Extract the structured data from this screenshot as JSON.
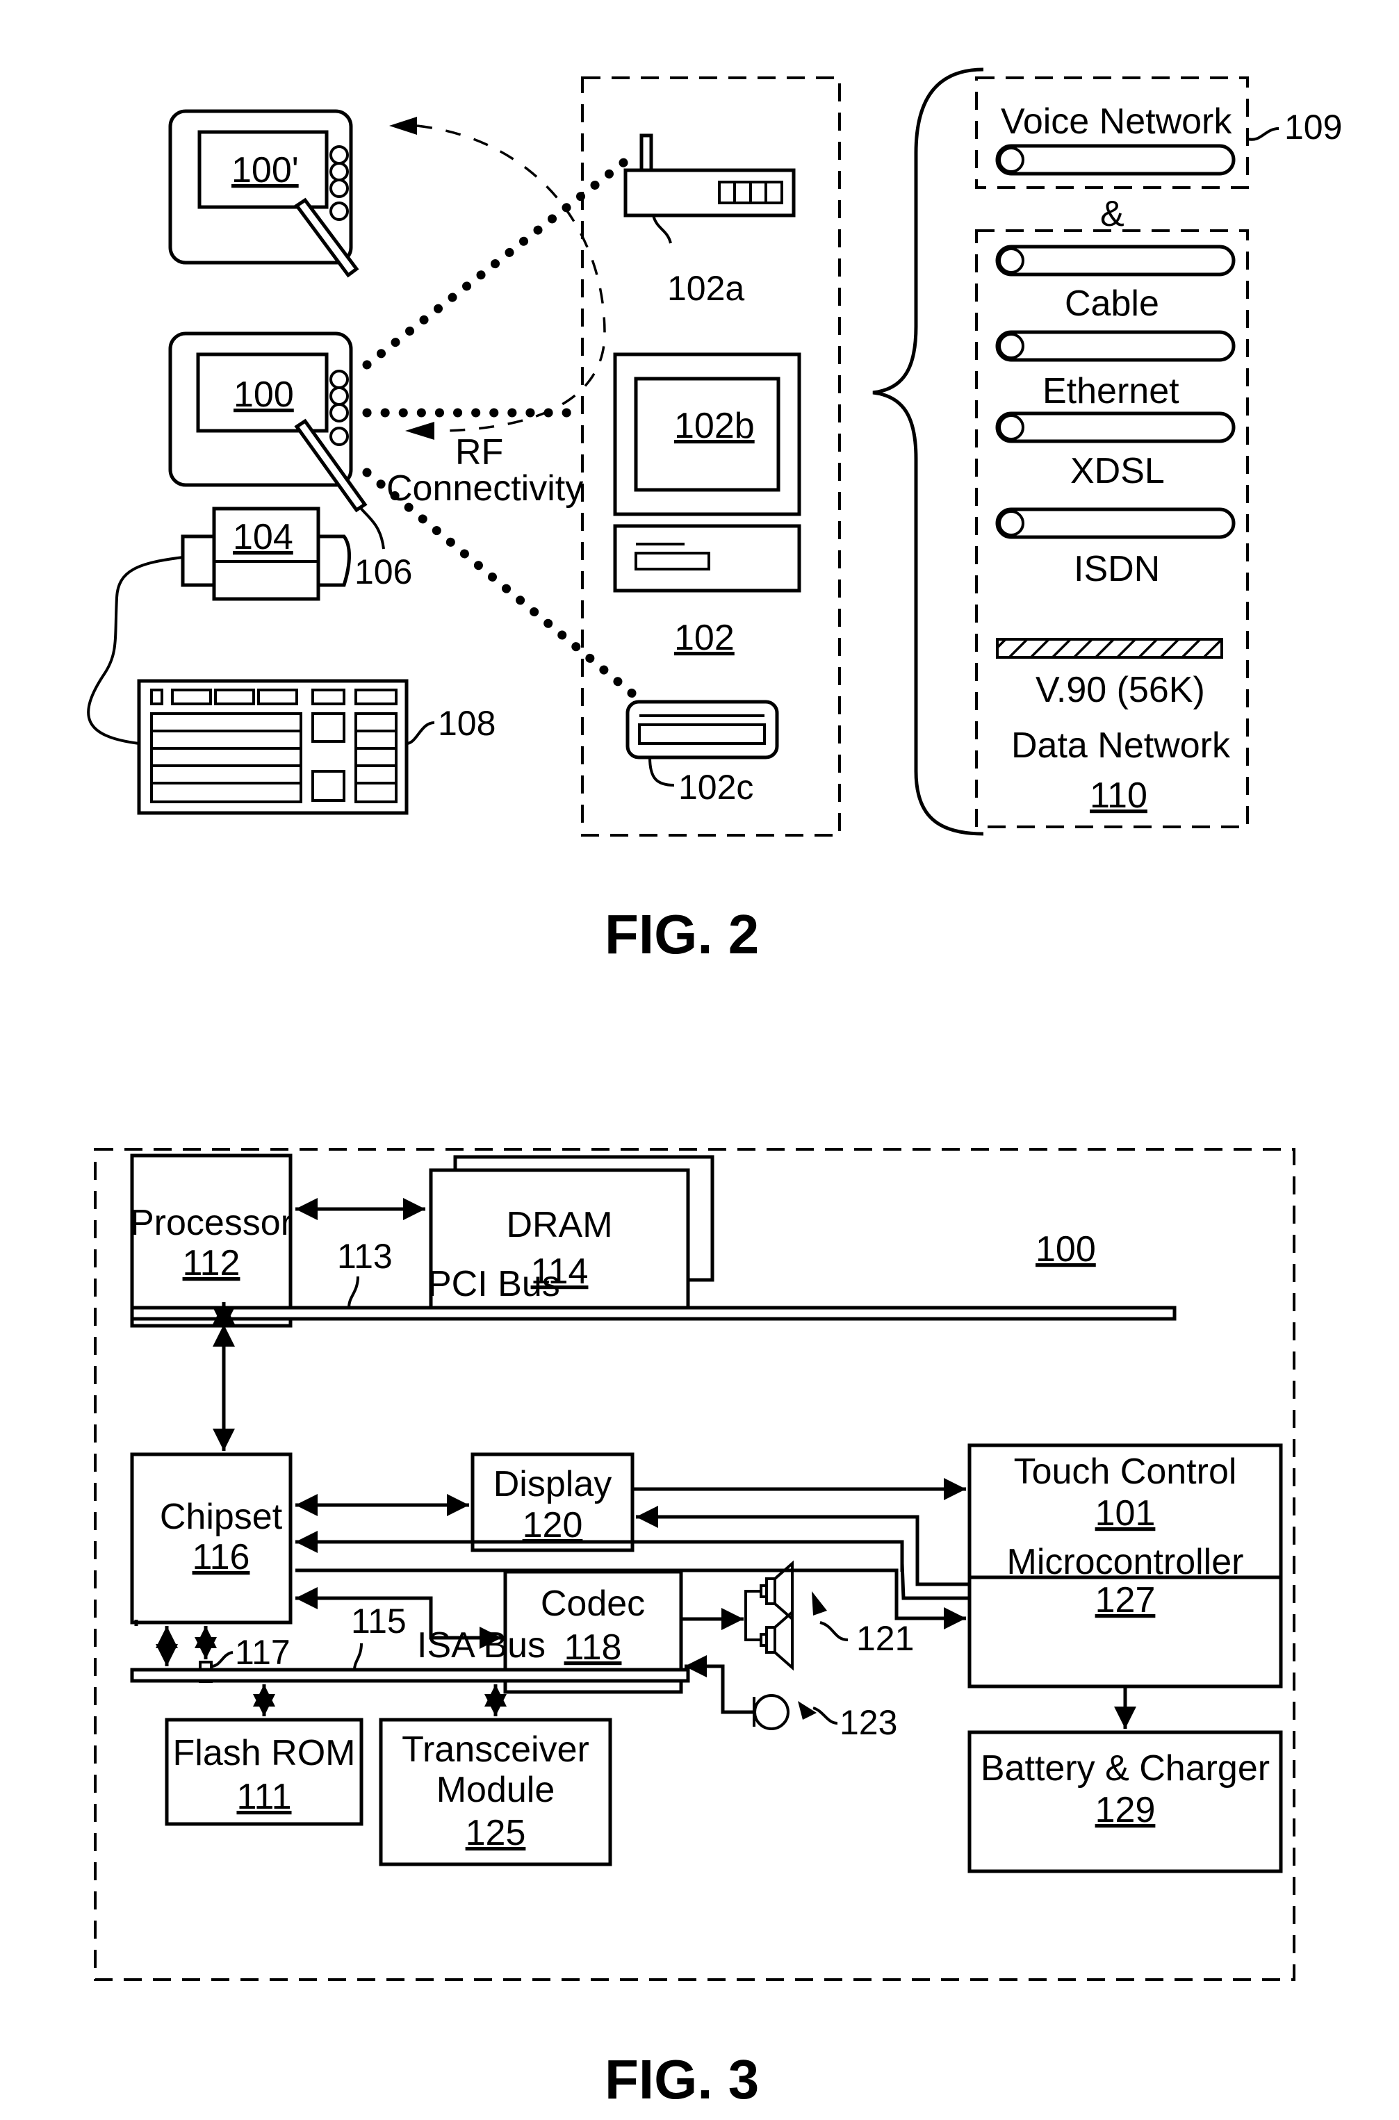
{
  "fig2": {
    "caption": "FIG. 2",
    "tablet_alt_label": "100'",
    "tablet_label": "100",
    "stylus_label": "106",
    "rf_line1": "RF",
    "rf_line2": "Connectivity",
    "printer_label": "104",
    "keyboard_label": "108",
    "access_point_label": "102a",
    "monitor_label": "102b",
    "host_group_label": "102",
    "card_label": "102c",
    "voice_network_title": "Voice Network",
    "voice_network_ref": "109",
    "ampersand": "&",
    "data_networks": [
      "Cable",
      "Ethernet",
      "XDSL",
      "ISDN",
      "V.90 (56K)"
    ],
    "data_network_title": "Data Network",
    "data_network_ref": "110"
  },
  "fig3": {
    "caption": "FIG. 3",
    "system_ref": "100",
    "blocks": {
      "processor": {
        "name": "Processor",
        "ref": "112"
      },
      "dram": {
        "name": "DRAM",
        "ref": "114"
      },
      "chipset": {
        "name": "Chipset",
        "ref": "116"
      },
      "display": {
        "name": "Display",
        "ref": "120"
      },
      "codec": {
        "name": "Codec",
        "ref": "118"
      },
      "touch_control": {
        "name": "Touch Control",
        "ref": "101"
      },
      "microcontroller": {
        "name": "Microcontroller",
        "ref": "127"
      },
      "battery": {
        "name": "Battery & Charger",
        "ref": "129"
      },
      "flash_rom": {
        "name": "Flash ROM",
        "ref": "111"
      },
      "transceiver_line1": "Transceiver",
      "transceiver_line2": "Module",
      "transceiver_ref": "125"
    },
    "pci_bus_label": "PCI Bus",
    "pci_bus_ref": "113",
    "isa_bus_label": "ISA Bus",
    "isa_bus_ref": "115",
    "component_117_ref": "117",
    "speakers_ref": "121",
    "microphone_ref": "123"
  }
}
